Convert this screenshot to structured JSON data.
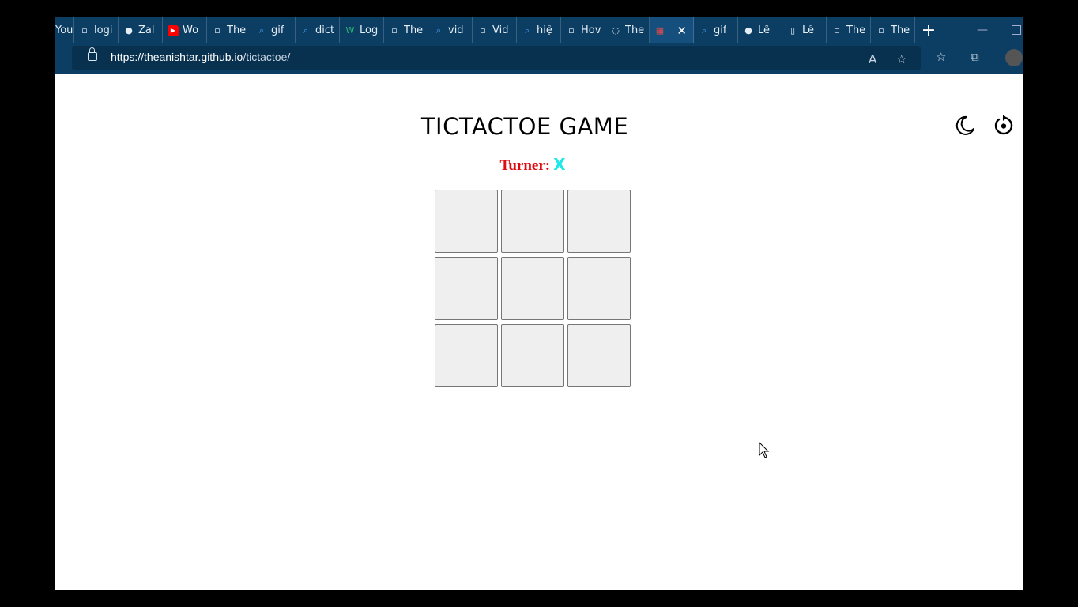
{
  "browser": {
    "tabs": [
      {
        "label": "You",
        "icon": "tab-icon"
      },
      {
        "label": "logi",
        "icon": "tab-icon"
      },
      {
        "label": "Zal",
        "icon": "avatar-icon"
      },
      {
        "label": "Wo",
        "icon": "youtube-icon"
      },
      {
        "label": "The",
        "icon": "tab-icon"
      },
      {
        "label": "gif",
        "icon": "search-icon"
      },
      {
        "label": "dict",
        "icon": "search-icon"
      },
      {
        "label": "Log",
        "icon": "w-icon"
      },
      {
        "label": "The",
        "icon": "tab-icon"
      },
      {
        "label": "vid",
        "icon": "search-icon"
      },
      {
        "label": "Vid",
        "icon": "tab-icon"
      },
      {
        "label": "hiệ",
        "icon": "search-icon"
      },
      {
        "label": "Hov",
        "icon": "tab-icon"
      },
      {
        "label": "The",
        "icon": "globe-icon"
      },
      {
        "label": "",
        "icon": "grid-icon",
        "active": true
      },
      {
        "label": "gif",
        "icon": "search-icon"
      },
      {
        "label": "Lê",
        "icon": "avatar-icon"
      },
      {
        "label": "Lê",
        "icon": "page-icon"
      },
      {
        "label": "The",
        "icon": "tab-icon"
      },
      {
        "label": "The",
        "icon": "tab-icon"
      }
    ],
    "url_host": "https://theanishtar.github.io",
    "url_path": "/tictactoe/"
  },
  "game": {
    "title": "TICTACTOE GAME",
    "turn_label": "Turner:",
    "turn_symbol": "X",
    "cells": [
      "",
      "",
      "",
      "",
      "",
      "",
      "",
      "",
      ""
    ]
  },
  "colors": {
    "turn_label": "#e00b10",
    "turn_symbol": "#1de9e9",
    "cell_bg": "#efefef",
    "chrome": "#0c3d63"
  }
}
